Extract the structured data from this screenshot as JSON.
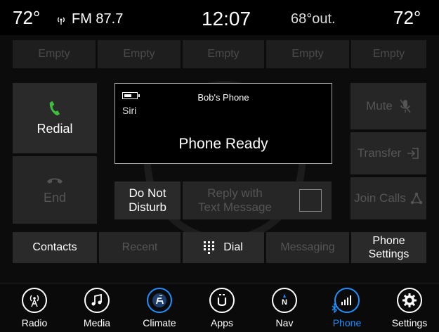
{
  "status": {
    "temp_left": "72°",
    "radio_icon": "radio-signal-icon",
    "radio": "FM 87.7",
    "time": "12:07",
    "outside_temp": "68°out.",
    "temp_right": "72°"
  },
  "favorites": [
    "Empty",
    "Empty",
    "Empty",
    "Empty",
    "Empty"
  ],
  "left_buttons": {
    "redial": "Redial",
    "end": "End"
  },
  "display": {
    "phone_name": "Bob's Phone",
    "siri": "Siri",
    "status": "Phone Ready"
  },
  "middle_buttons": {
    "do_not_disturb_line1": "Do Not",
    "do_not_disturb_line2": "Disturb",
    "reply_line1": "Reply with",
    "reply_line2": "Text Message"
  },
  "right_buttons": {
    "mute": "Mute",
    "transfer": "Transfer",
    "join_calls": "Join Calls"
  },
  "tabs": {
    "contacts": "Contacts",
    "recent": "Recent",
    "dial": "Dial",
    "messaging": "Messaging",
    "phone_settings_line1": "Phone",
    "phone_settings_line2": "Settings"
  },
  "nav": {
    "radio": "Radio",
    "media": "Media",
    "climate": "Climate",
    "apps": "Apps",
    "nav": "Nav",
    "phone": "Phone",
    "settings": "Settings"
  },
  "colors": {
    "accent": "#1e90ff",
    "call_green": "#3dbf3d",
    "tile": "#2a2a2a"
  }
}
